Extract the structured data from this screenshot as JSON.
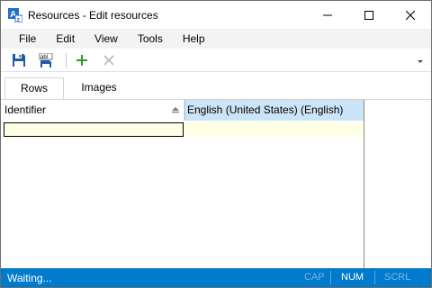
{
  "window": {
    "title": "Resources - Edit resources",
    "app_icon": "resource-editor-icon",
    "controls": {
      "minimize": "minimize-icon",
      "maximize": "maximize-icon",
      "close": "close-icon"
    }
  },
  "menu": {
    "items": [
      {
        "label": "File"
      },
      {
        "label": "Edit"
      },
      {
        "label": "View"
      },
      {
        "label": "Tools"
      },
      {
        "label": "Help"
      }
    ]
  },
  "toolbar": {
    "buttons": [
      {
        "icon": "save-icon",
        "enabled": true
      },
      {
        "icon": "save-text-icon",
        "enabled": true
      },
      {
        "icon": "add-icon",
        "enabled": true
      },
      {
        "icon": "delete-icon",
        "enabled": false
      }
    ],
    "overflow_icon": "chevron-down-icon"
  },
  "tabs": [
    {
      "label": "Rows",
      "active": true
    },
    {
      "label": "Images",
      "active": false
    }
  ],
  "grid": {
    "columns": [
      {
        "label": "Identifier",
        "sort_icon": "sort-ascending-icon"
      },
      {
        "label": "English (United States) (English)",
        "selected": true
      }
    ],
    "rows": [
      {
        "identifier": "",
        "english": ""
      }
    ]
  },
  "status": {
    "text": "Waiting...",
    "indicators": [
      {
        "label": "CAP",
        "active": false
      },
      {
        "label": "NUM",
        "active": true
      },
      {
        "label": "SCRL",
        "active": false
      }
    ]
  },
  "colors": {
    "status_bar": "#007acc",
    "selected_header": "#cce4f7",
    "edit_row": "#ffffe6",
    "add_icon": "#2a9d2a",
    "save_icon": "#1e5aa8"
  }
}
